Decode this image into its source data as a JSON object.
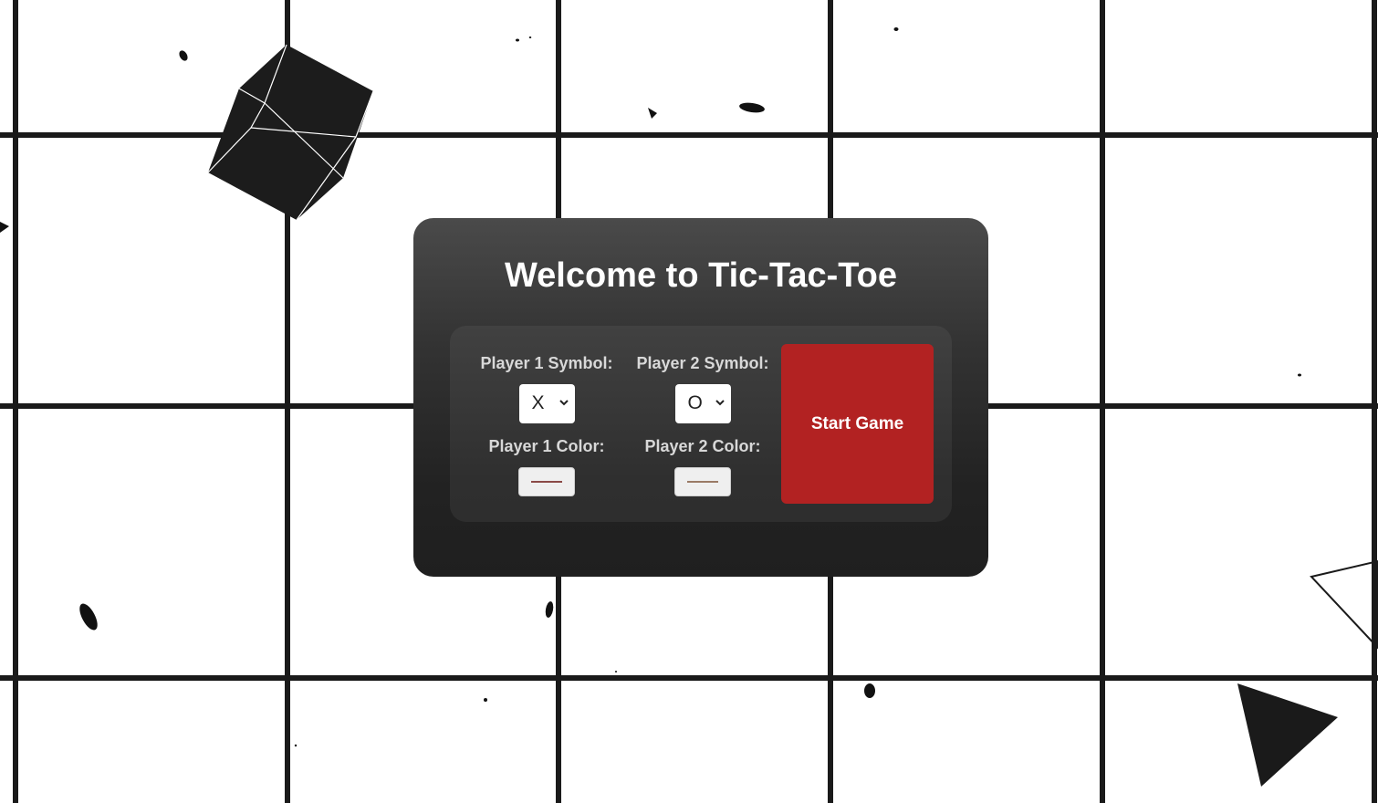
{
  "title": "Welcome to Tic-Tac-Toe",
  "player1": {
    "symbol_label": "Player 1 Symbol:",
    "symbol_value": "X",
    "color_label": "Player 1 Color:",
    "color_value": "#8b4a47"
  },
  "player2": {
    "symbol_label": "Player 2 Symbol:",
    "symbol_value": "O",
    "color_label": "Player 2 Color:",
    "color_value": "#9a7a66"
  },
  "start_button": "Start Game",
  "colors": {
    "accent": "#b22222",
    "panel": "#2e2e2e",
    "grid": "#1a1a1a"
  }
}
